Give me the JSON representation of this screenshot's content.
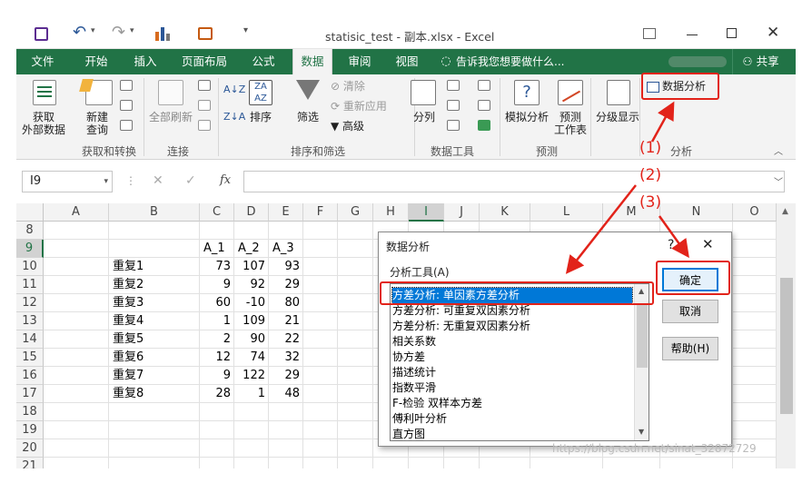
{
  "title": {
    "filename": "statisic_test - 副本.xlsx - Excel",
    "help": "?"
  },
  "tabs": [
    "文件",
    "开始",
    "插入",
    "页面布局",
    "公式",
    "数据",
    "审阅",
    "视图"
  ],
  "tell_me": "告诉我您想要做什么...",
  "share": "共享",
  "ribbon": {
    "get_external": "获取\n外部数据",
    "new_query": "新建\n查询",
    "refresh_all": "全部刷新",
    "sort": "排序",
    "filter": "筛选",
    "clear": "清除",
    "reapply": "重新应用",
    "advanced": "高级",
    "split": "分列",
    "simulate": "模拟分析",
    "forecast": "预测\n工作表",
    "outline": "分级显示",
    "data_analysis": "数据分析",
    "groups": {
      "get_transform": "获取和转换",
      "connections": "连接",
      "sort_filter": "排序和筛选",
      "data_tools": "数据工具",
      "forecast": "预测",
      "analysis": "分析"
    }
  },
  "formula_bar": {
    "name_box": "I9",
    "fx": "fx",
    "formula": ""
  },
  "sheet": {
    "columns": [
      "A",
      "B",
      "C",
      "D",
      "E",
      "F",
      "G",
      "H",
      "I",
      "J",
      "K",
      "L",
      "M",
      "N",
      "O"
    ],
    "rows": [
      "8",
      "9",
      "10",
      "11",
      "12",
      "13",
      "14",
      "15",
      "16",
      "17",
      "18",
      "19",
      "20",
      "21"
    ],
    "headers": [
      "A_1",
      "A_2",
      "A_3"
    ],
    "data": [
      [
        "重复1",
        "73",
        "107",
        "93"
      ],
      [
        "重复2",
        "9",
        "92",
        "29"
      ],
      [
        "重复3",
        "60",
        "-10",
        "80"
      ],
      [
        "重复4",
        "1",
        "109",
        "21"
      ],
      [
        "重复5",
        "2",
        "90",
        "22"
      ],
      [
        "重复6",
        "12",
        "74",
        "32"
      ],
      [
        "重复7",
        "9",
        "122",
        "29"
      ],
      [
        "重复8",
        "28",
        "1",
        "48"
      ]
    ]
  },
  "dialog": {
    "title": "数据分析",
    "help": "?",
    "tools_label": "分析工具(A)",
    "tools": [
      "方差分析: 单因素方差分析",
      "方差分析: 可重复双因素分析",
      "方差分析: 无重复双因素分析",
      "相关系数",
      "协方差",
      "描述统计",
      "指数平滑",
      "F-检验 双样本方差",
      "傅利叶分析",
      "直方图"
    ],
    "selected": 0,
    "ok": "确定",
    "cancel": "取消",
    "help_btn": "帮助(H)"
  },
  "annotations": {
    "step1": "(1)",
    "step2": "(2)",
    "step3": "(3)",
    "red": "#e2231a"
  },
  "watermark": "https://blog.csdn.net/sinat_32872729",
  "colors": {
    "excel_green": "#217346",
    "selection_blue": "#0078d7"
  }
}
